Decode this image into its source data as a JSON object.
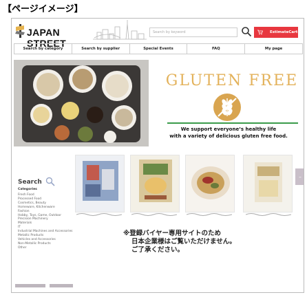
{
  "page_label": "【ページイメージ】",
  "header": {
    "logo_text": "JAPAN STREET",
    "search_placeholder": "Search by keyword",
    "cart_label": "EstimateCart"
  },
  "nav": {
    "items": [
      "Search by category",
      "Search by supplier",
      "Special Events",
      "FAQ",
      "My page"
    ]
  },
  "hero": {
    "title": "GLUTEN FREE",
    "tagline_1": "We support everyone’s healthy life",
    "tagline_2": "with a variety of delicious gluten free food."
  },
  "sidebar": {
    "title": "Search",
    "categories_heading": "Categories",
    "categories": [
      "Fresh Food",
      "Processed Food",
      "Cosmetics, Beauty",
      "Homeware, Kitchenware",
      "Fashion",
      "Hobby, Toys, Game, Outdoor",
      "Precision Machinery",
      "Materials",
      "IT",
      "Industrial Machines and Accessories",
      "Metallic Products",
      "Vehicles and Accessories",
      "Non-Metallic Products",
      "Other"
    ]
  },
  "products": {
    "count_shown": 4,
    "side_tab": "–"
  },
  "notice": {
    "line_1": "※登録バイヤー専用サイトのため",
    "line_2": "日本企業様はご覧いただけません。",
    "line_3": "ご了承ください。"
  },
  "colors": {
    "accent_red": "#e8373f",
    "gluten_gold": "#e3b25b",
    "tagline_green": "#3a9b4a"
  }
}
